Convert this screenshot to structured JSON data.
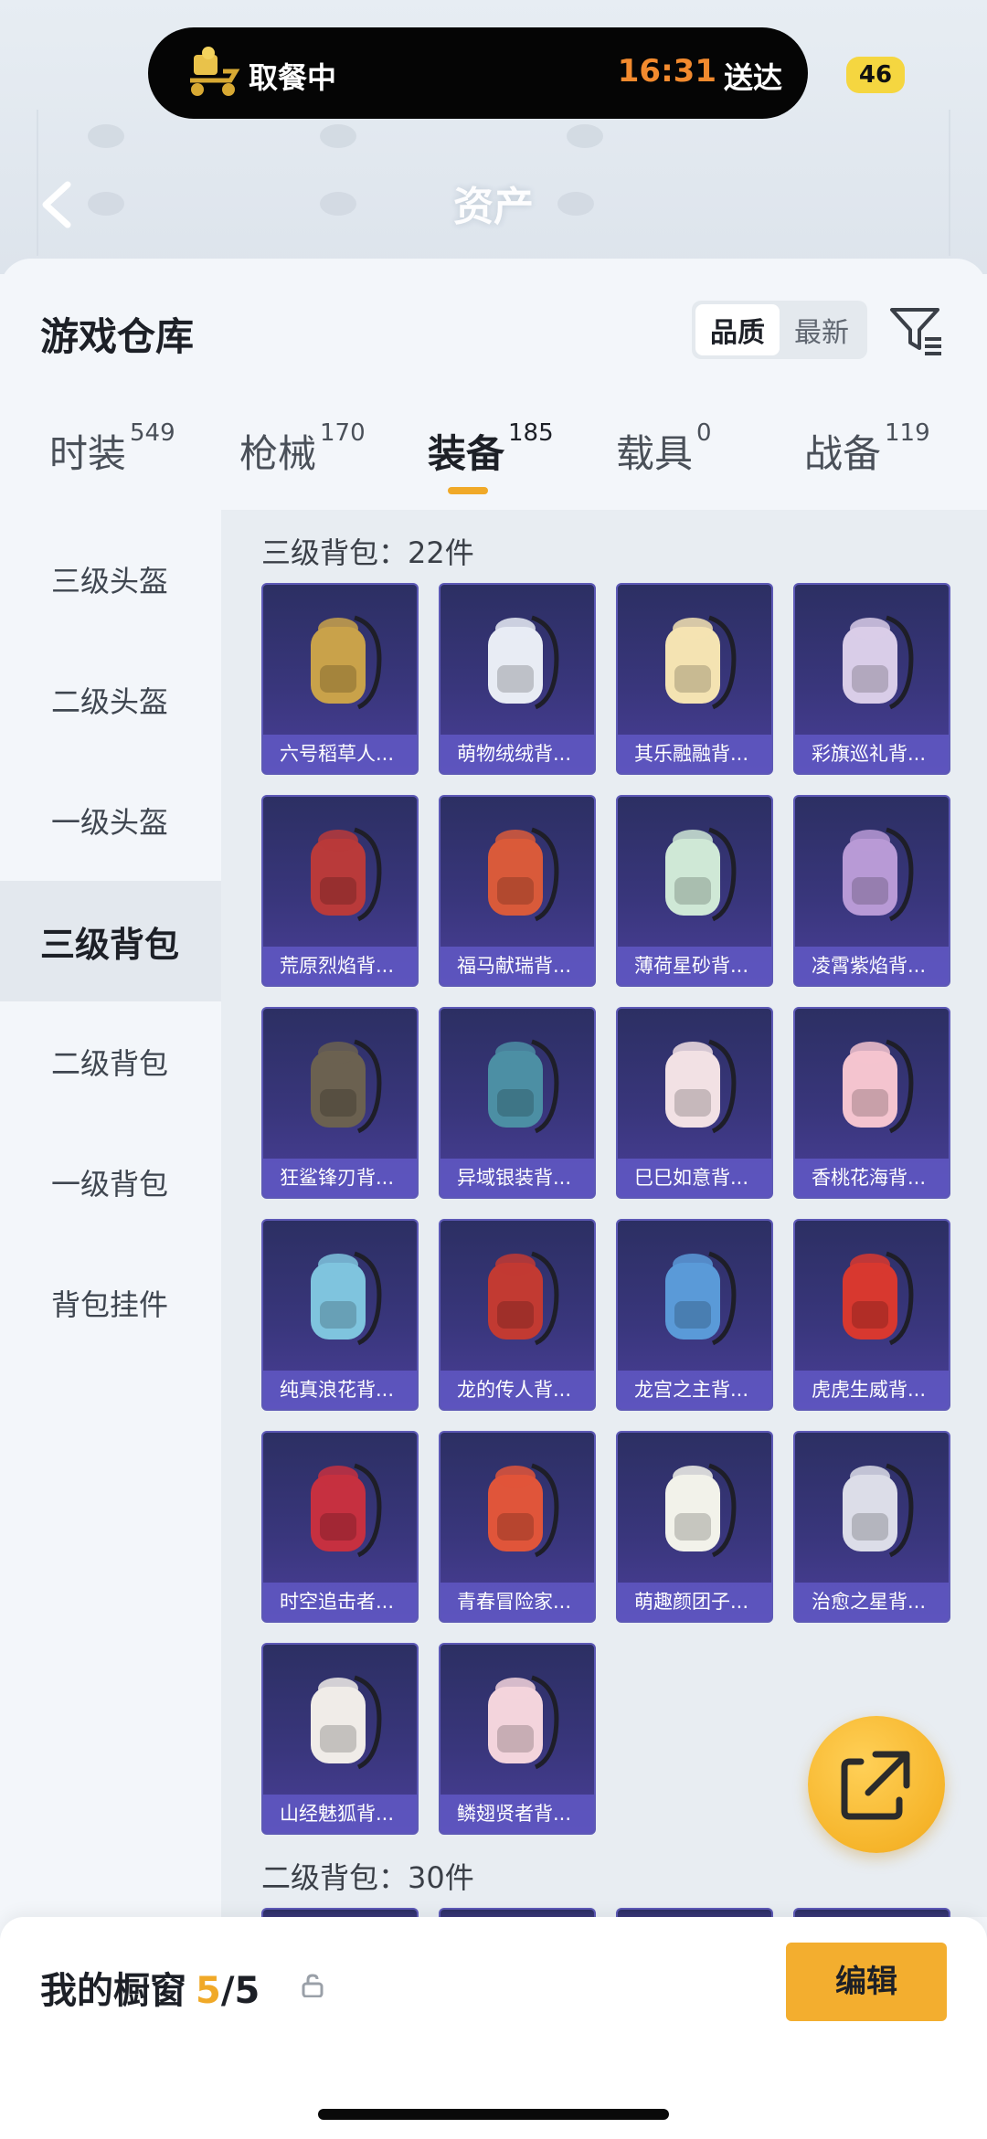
{
  "status": {
    "delivery_status": "取餐中",
    "delivery_time": "16:31",
    "delivery_suffix": "送达",
    "battery": "46"
  },
  "header": {
    "title": "资产"
  },
  "warehouse": {
    "title": "游戏仓库",
    "sort_options": [
      "品质",
      "最新"
    ],
    "active_sort": "品质"
  },
  "tabs": [
    {
      "label": "时装",
      "count": "549"
    },
    {
      "label": "枪械",
      "count": "170"
    },
    {
      "label": "装备",
      "count": "185"
    },
    {
      "label": "载具",
      "count": "0"
    },
    {
      "label": "战备",
      "count": "119"
    }
  ],
  "active_tab": "装备",
  "sidebar": {
    "items": [
      "三级头盔",
      "二级头盔",
      "一级头盔",
      "三级背包",
      "二级背包",
      "一级背包",
      "背包挂件"
    ],
    "active": "三级背包"
  },
  "sections": [
    {
      "title": "三级背包：22件",
      "items": [
        {
          "name": "六号稻草人...",
          "color": "#c9a24a"
        },
        {
          "name": "萌物绒绒背...",
          "color": "#e8ecf4"
        },
        {
          "name": "其乐融融背...",
          "color": "#f4e3b2"
        },
        {
          "name": "彩旗巡礼背...",
          "color": "#d9cde8"
        },
        {
          "name": "荒原烈焰背...",
          "color": "#b93a3a"
        },
        {
          "name": "福马献瑞背...",
          "color": "#d95a3a"
        },
        {
          "name": "薄荷星砂背...",
          "color": "#cfe8d6"
        },
        {
          "name": "凌霄紫焰背...",
          "color": "#b89ad6"
        },
        {
          "name": "狂鲨锋刃背...",
          "color": "#6b6150"
        },
        {
          "name": "异域银装背...",
          "color": "#4c8fa4"
        },
        {
          "name": "巳巳如意背...",
          "color": "#f2e1e4"
        },
        {
          "name": "香桃花海背...",
          "color": "#f4c4cf"
        },
        {
          "name": "纯真浪花背...",
          "color": "#7fc4de"
        },
        {
          "name": "龙的传人背...",
          "color": "#c23a32"
        },
        {
          "name": "龙宫之主背...",
          "color": "#5a9ad8"
        },
        {
          "name": "虎虎生威背...",
          "color": "#d8382f"
        },
        {
          "name": "时空追击者...",
          "color": "#c63040"
        },
        {
          "name": "青春冒险家...",
          "color": "#e0553a"
        },
        {
          "name": "萌趣颜团子...",
          "color": "#f2f2ea"
        },
        {
          "name": "治愈之星背...",
          "color": "#dcdde8"
        },
        {
          "name": "山经魅狐背...",
          "color": "#f0ece8"
        },
        {
          "name": "鳞翅贤者背...",
          "color": "#f3d4dc"
        }
      ]
    },
    {
      "title": "二级背包：30件"
    }
  ],
  "showcase": {
    "label": "我的橱窗",
    "count": "5",
    "total": "/5",
    "edit_label": "编辑"
  }
}
